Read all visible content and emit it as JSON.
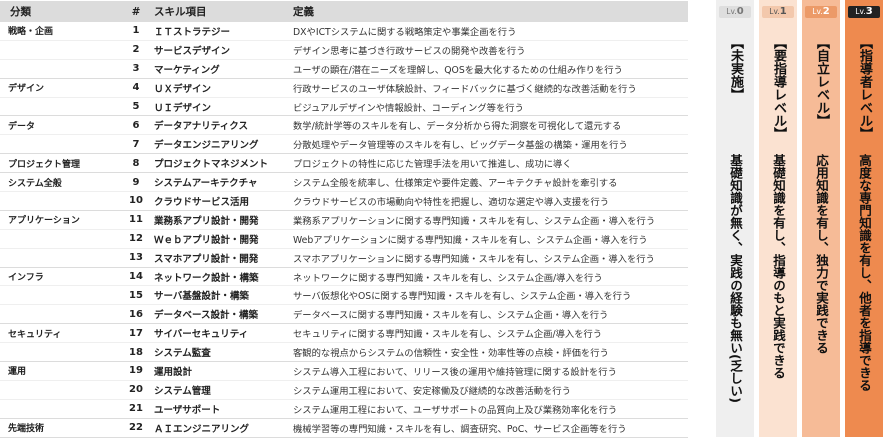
{
  "table": {
    "headers": {
      "category": "分類",
      "number": "#",
      "item": "スキル項目",
      "definition": "定義"
    },
    "rows": [
      {
        "category": "戦略・企画",
        "number": "1",
        "item": "ＩＴストラテジー",
        "definition": "DXやICTシステムに関する戦略策定や事業企画を行う"
      },
      {
        "category": "",
        "number": "2",
        "item": "サービスデザイン",
        "definition": "デザイン思考に基づき行政サービスの開発や改善を行う"
      },
      {
        "category": "",
        "number": "3",
        "item": "マーケティング",
        "definition": "ユーザの顕在/潜在ニーズを理解し、QOSを最大化するための仕組み作りを行う"
      },
      {
        "category": "デザイン",
        "number": "4",
        "item": "ＵＸデザイン",
        "definition": "行政サービスのユーザ体験設計、フィードバックに基づく継続的な改善活動を行う"
      },
      {
        "category": "",
        "number": "5",
        "item": "ＵＩデザイン",
        "definition": "ビジュアルデザインや情報設計、コーディング等を行う"
      },
      {
        "category": "データ",
        "number": "6",
        "item": "データアナリティクス",
        "definition": "数学/統計学等のスキルを有し、データ分析から得た洞察を可視化して還元する"
      },
      {
        "category": "",
        "number": "7",
        "item": "データエンジニアリング",
        "definition": "分散処理やデータ管理等のスキルを有し、ビッグデータ基盤の構築・運用を行う"
      },
      {
        "category": "プロジェクト管理",
        "number": "8",
        "item": "プロジェクトマネジメント",
        "definition": "プロジェクトの特性に応じた管理手法を用いて推進し、成功に導く"
      },
      {
        "category": "システム全般",
        "number": "9",
        "item": "システムアーキテクチャ",
        "definition": "システム全般を統率し、仕様策定や要件定義、アーキテクチャ設計を牽引する"
      },
      {
        "category": "",
        "number": "10",
        "item": "クラウドサービス活用",
        "definition": "クラウドサービスの市場動向や特性を把握し、適切な選定や導入支援を行う"
      },
      {
        "category": "アプリケーション",
        "number": "11",
        "item": "業務系アプリ設計・開発",
        "definition": "業務系アプリケーションに関する専門知識・スキルを有し、システム企画・導入を行う"
      },
      {
        "category": "",
        "number": "12",
        "item": "Ｗｅｂアプリ設計・開発",
        "definition": "Webアプリケーションに関する専門知識・スキルを有し、システム企画・導入を行う"
      },
      {
        "category": "",
        "number": "13",
        "item": "スマホアプリ設計・開発",
        "definition": "スマホアプリケーションに関する専門知識・スキルを有し、システム企画・導入を行う"
      },
      {
        "category": "インフラ",
        "number": "14",
        "item": "ネットワーク設計・構築",
        "definition": "ネットワークに関する専門知識・スキルを有し、システム企画/導入を行う"
      },
      {
        "category": "",
        "number": "15",
        "item": "サーバ基盤設計・構築",
        "definition": "サーバ仮想化やOSに関する専門知識・スキルを有し、システム企画・導入を行う"
      },
      {
        "category": "",
        "number": "16",
        "item": "データベース設計・構築",
        "definition": "データベースに関する専門知識・スキルを有し、システム企画・導入を行う"
      },
      {
        "category": "セキュリティ",
        "number": "17",
        "item": "サイバーセキュリティ",
        "definition": "セキュリティに関する専門知識・スキルを有し、システム企画/導入を行う"
      },
      {
        "category": "",
        "number": "18",
        "item": "システム監査",
        "definition": "客観的な視点からシステムの信頼性・安全性・効率性等の点検・評価を行う"
      },
      {
        "category": "運用",
        "number": "19",
        "item": "運用設計",
        "definition": "システム導入工程において、リリース後の運用や維持管理に関する設計を行う"
      },
      {
        "category": "",
        "number": "20",
        "item": "システム管理",
        "definition": "システム運用工程において、安定稼働及び継続的な改善活動を行う"
      },
      {
        "category": "",
        "number": "21",
        "item": "ユーザサポート",
        "definition": "システム運用工程において、ユーザサポートの品質向上及び業務効率化を行う"
      },
      {
        "category": "先端技術",
        "number": "22",
        "item": "ＡＩエンジニアリング",
        "definition": "機械学習等の専門知識・スキルを有し、調査研究、PoC、サービス企画等を行う"
      }
    ]
  },
  "levels": [
    {
      "prefix": "Lv.",
      "num": "0",
      "title": "【未実施】",
      "description": "基礎知識が無く、実践の経験も無い(乏しい)",
      "color": "#efefef"
    },
    {
      "prefix": "Lv.",
      "num": "1",
      "title": "【要指導レベル】",
      "description": "基礎知識を有し、指導のもと実践できる",
      "color": "#fbe2d1"
    },
    {
      "prefix": "Lv.",
      "num": "2",
      "title": "【自立レベル】",
      "description": "応用知識を有し、独力で実践できる",
      "color": "#f6bb97"
    },
    {
      "prefix": "Lv.",
      "num": "3",
      "title": "【指導者レベル】",
      "description": "高度な専門知識を有し、他者を指導できる",
      "color": "#ee8a4f"
    }
  ]
}
